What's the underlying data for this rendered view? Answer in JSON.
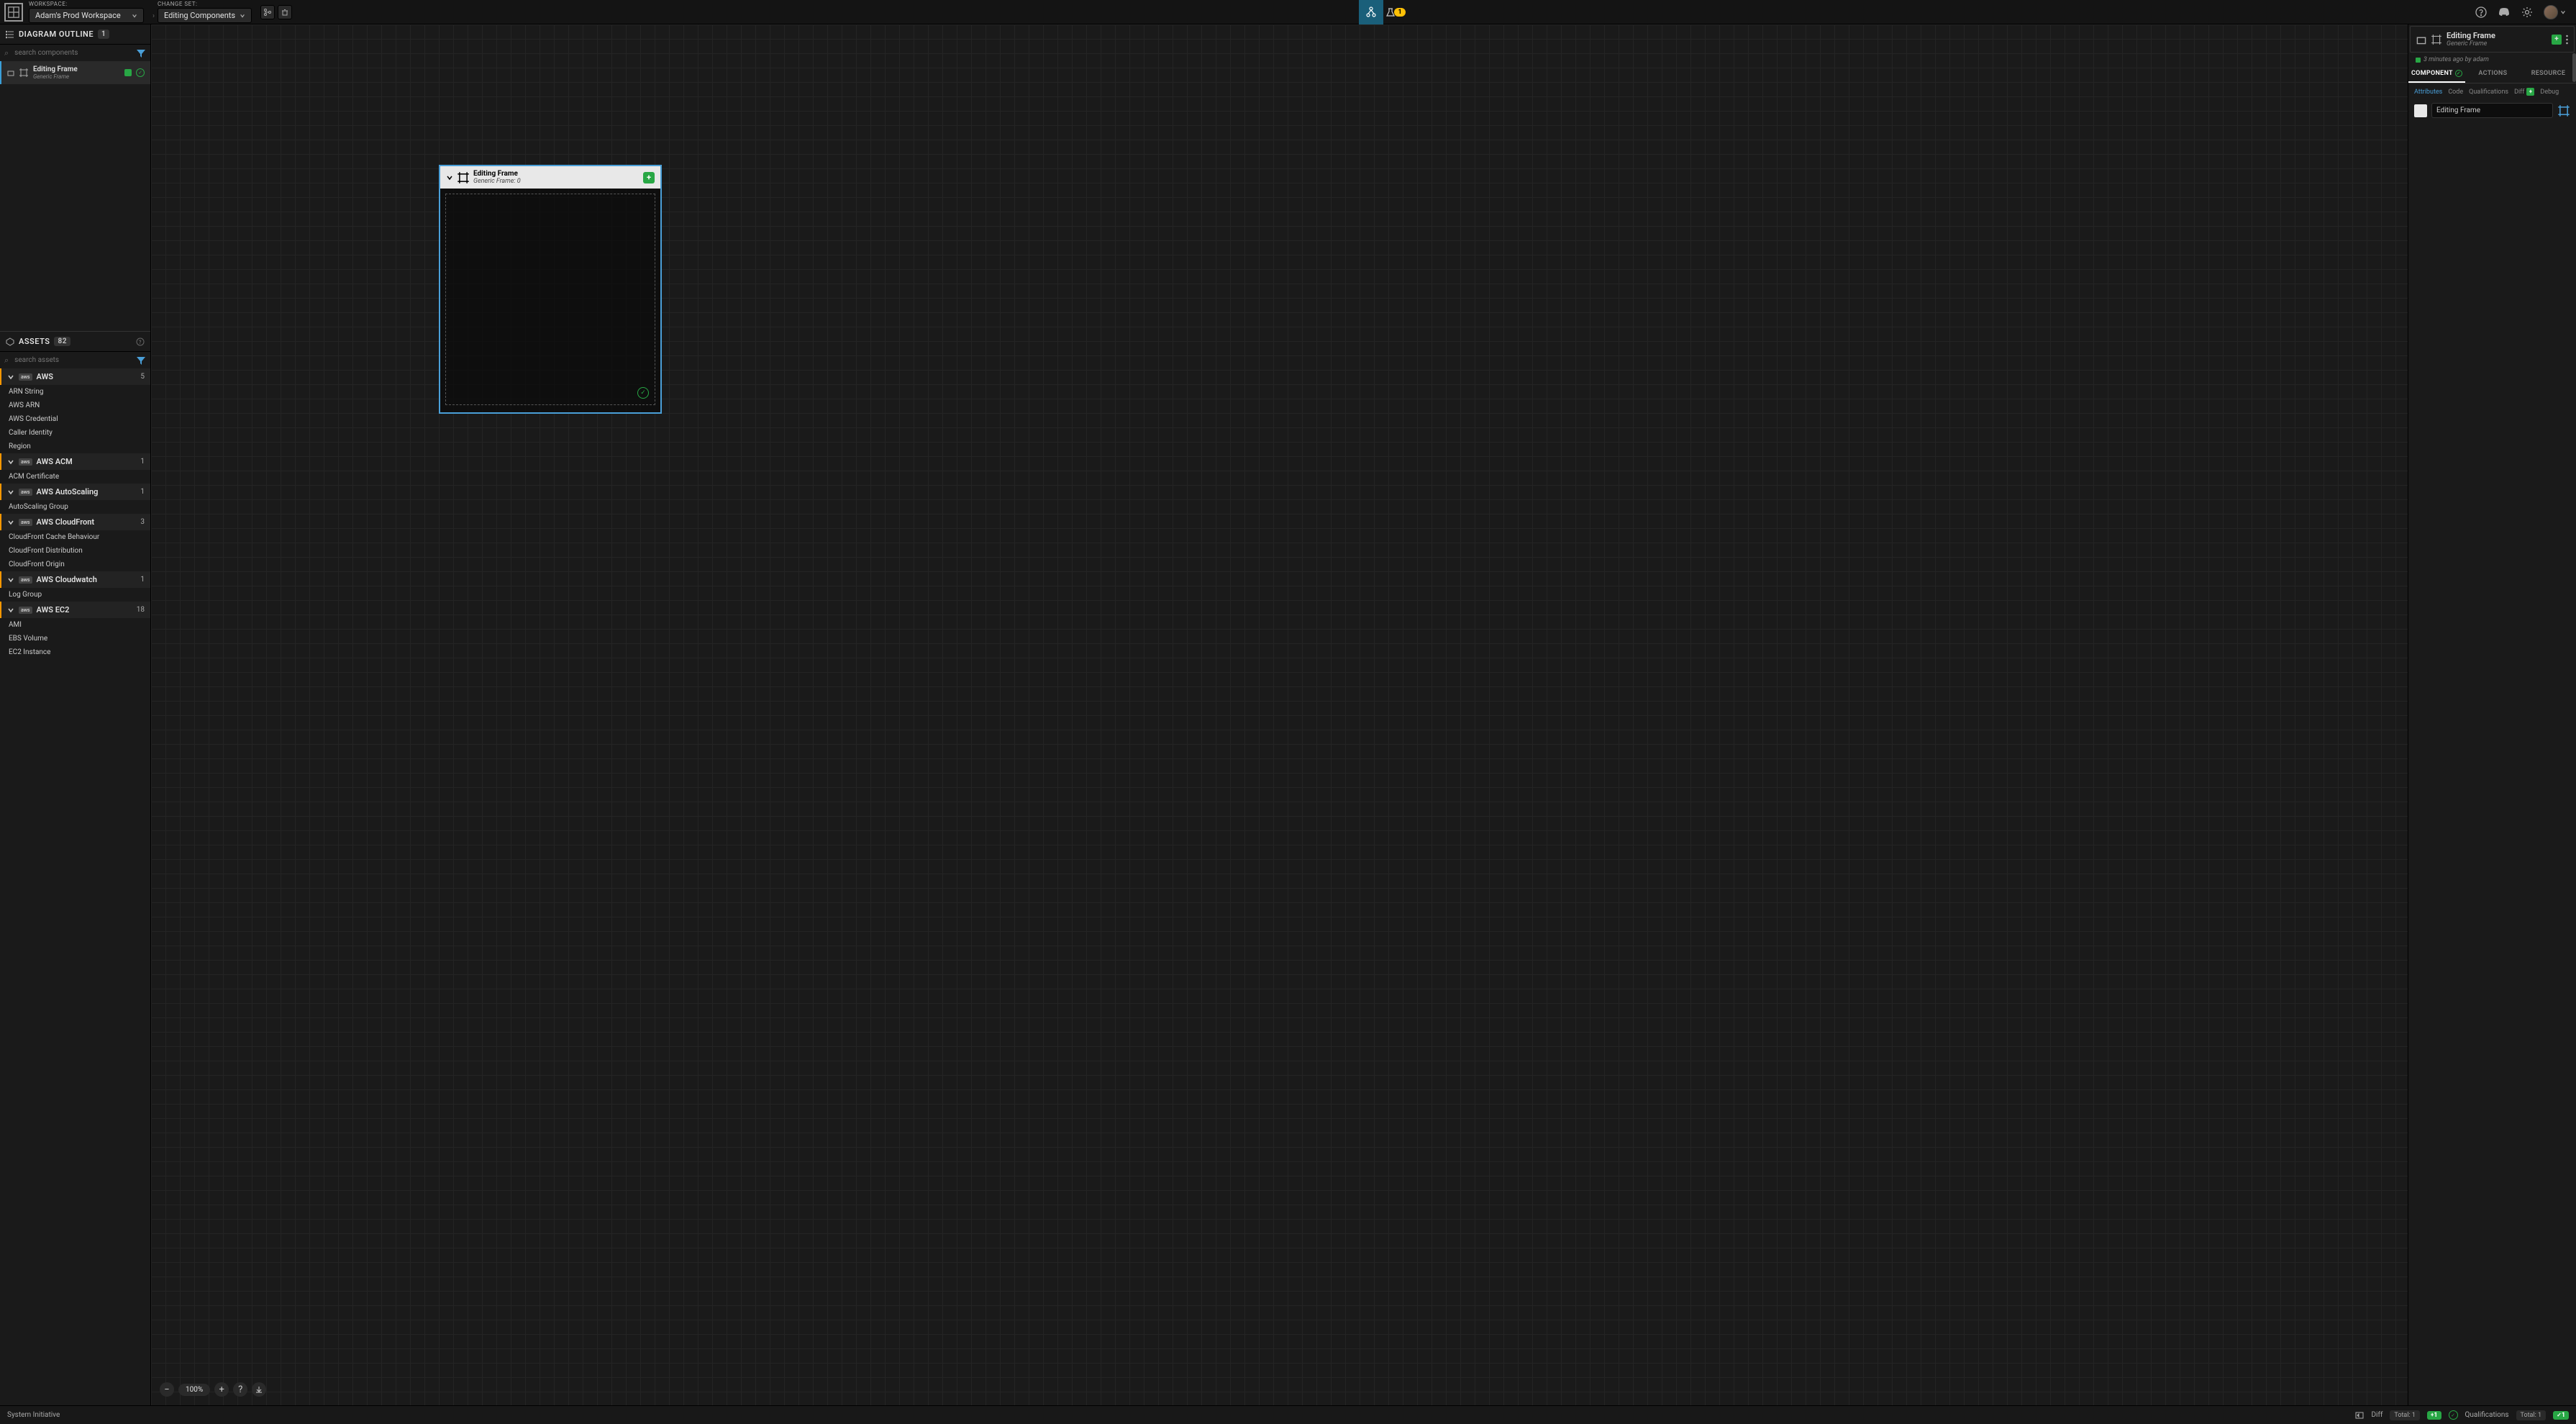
{
  "topbar": {
    "workspace_label": "WORKSPACE:",
    "workspace_name": "Adam's Prod Workspace",
    "changeset_label": "CHANGE SET:",
    "changeset_name": "Editing Components",
    "beaker_badge": "1"
  },
  "outline": {
    "header": "DIAGRAM OUTLINE",
    "count": "1",
    "search_placeholder": "search components",
    "item": {
      "title": "Editing Frame",
      "subtitle": "Generic Frame"
    }
  },
  "assets": {
    "header": "ASSETS",
    "count": "82",
    "search_placeholder": "search assets",
    "categories": [
      {
        "name": "AWS",
        "count": "5",
        "items": [
          "ARN String",
          "AWS ARN",
          "AWS Credential",
          "Caller Identity",
          "Region"
        ]
      },
      {
        "name": "AWS ACM",
        "count": "1",
        "items": [
          "ACM Certificate"
        ]
      },
      {
        "name": "AWS AutoScaling",
        "count": "1",
        "items": [
          "AutoScaling Group"
        ]
      },
      {
        "name": "AWS CloudFront",
        "count": "3",
        "items": [
          "CloudFront Cache Behaviour",
          "CloudFront Distribution",
          "CloudFront Origin"
        ]
      },
      {
        "name": "AWS Cloudwatch",
        "count": "1",
        "items": [
          "Log Group"
        ]
      },
      {
        "name": "AWS EC2",
        "count": "18",
        "items": [
          "AMI",
          "EBS Volume",
          "EC2 Instance"
        ]
      }
    ]
  },
  "canvas": {
    "frame_title": "Editing Frame",
    "frame_subtitle": "Generic Frame: 0",
    "zoom": "100%"
  },
  "right": {
    "title": "Editing Frame",
    "subtitle": "Generic Frame",
    "timestamp": "3 minutes ago by adam",
    "tabs": {
      "component": "COMPONENT",
      "actions": "ACTIONS",
      "resource": "RESOURCE"
    },
    "subtabs": {
      "attributes": "Attributes",
      "code": "Code",
      "qualifications": "Qualifications",
      "diff": "Diff",
      "debug": "Debug"
    },
    "name_value": "Editing Frame"
  },
  "footer": {
    "brand": "System Initiative",
    "diff": "Diff",
    "total1": "Total: 1",
    "badge1": "1",
    "qualifications": "Qualifications",
    "total2": "Total: 1",
    "badge2": "1"
  }
}
